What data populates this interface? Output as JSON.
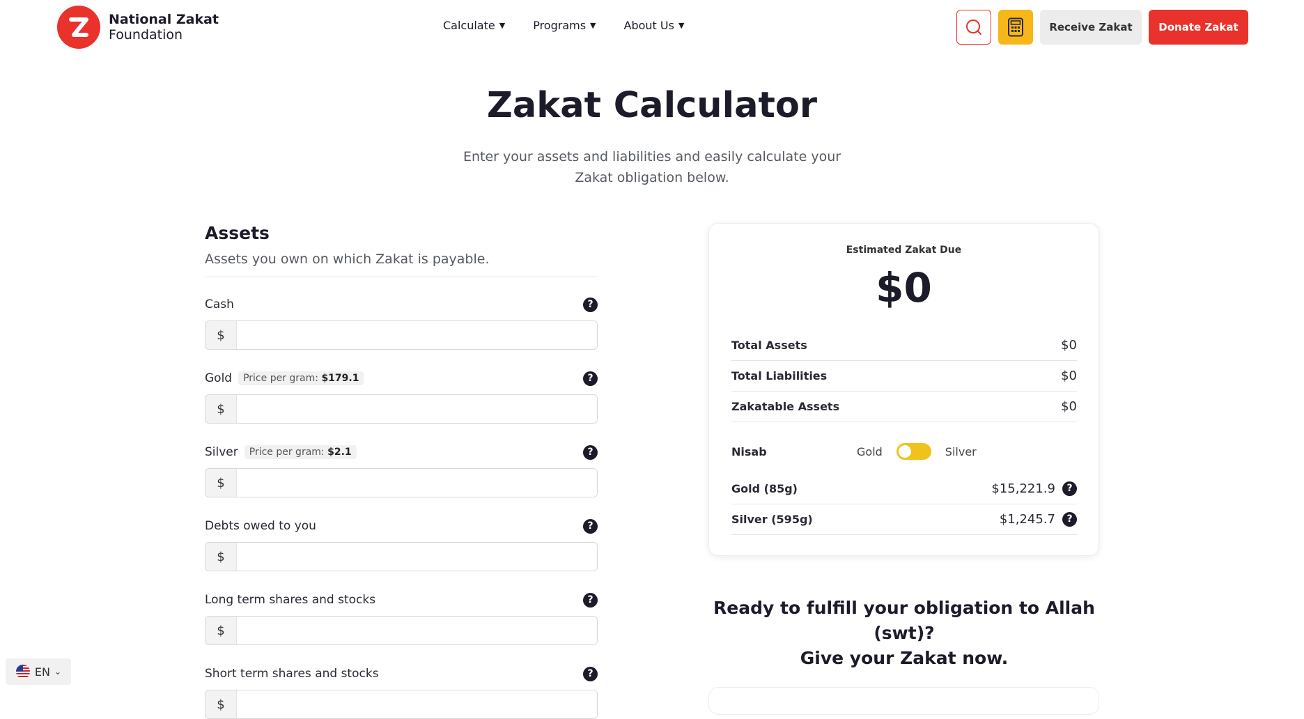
{
  "header": {
    "logo_line1": "National Zakat",
    "logo_line2": "Foundation",
    "nav": [
      {
        "label": "Calculate"
      },
      {
        "label": "Programs"
      },
      {
        "label": "About Us"
      }
    ],
    "receive_label": "Receive Zakat",
    "donate_label": "Donate Zakat",
    "icons": {
      "search": "search-icon",
      "calculator": "calculator-icon"
    },
    "colors": {
      "brand_red": "#e8322b",
      "accent_yellow": "#f7b718"
    }
  },
  "hero": {
    "title": "Zakat Calculator",
    "subtitle": "Enter your assets and liabilities and easily calculate your Zakat obligation below."
  },
  "assets": {
    "heading": "Assets",
    "description": "Assets you own on which Zakat is payable.",
    "fields": [
      {
        "label": "Cash",
        "prefix": "$",
        "value": ""
      },
      {
        "label": "Gold",
        "price_label": "Price per gram:",
        "price_value": "$179.1",
        "prefix": "$",
        "value": ""
      },
      {
        "label": "Silver",
        "price_label": "Price per gram:",
        "price_value": "$2.1",
        "prefix": "$",
        "value": ""
      },
      {
        "label": "Debts owed to you",
        "prefix": "$",
        "value": ""
      },
      {
        "label": "Long term shares and stocks",
        "prefix": "$",
        "value": ""
      },
      {
        "label": "Short term shares and stocks",
        "prefix": "$",
        "value": ""
      }
    ]
  },
  "summary": {
    "estimated_label": "Estimated Zakat Due",
    "estimated_value": "$0",
    "rows": [
      {
        "label": "Total Assets",
        "value": "$0"
      },
      {
        "label": "Total Liabilities",
        "value": "$0"
      },
      {
        "label": "Zakatable Assets",
        "value": "$0"
      }
    ],
    "nisab": {
      "label": "Nisab",
      "option_left": "Gold",
      "option_right": "Silver",
      "selected": "Gold"
    },
    "metals": [
      {
        "label": "Gold (85g)",
        "value": "$15,221.9"
      },
      {
        "label": "Silver (595g)",
        "value": "$1,245.7"
      }
    ]
  },
  "cta": {
    "line1": "Ready to fulfill your obligation to Allah (swt)?",
    "line2": "Give your Zakat now."
  },
  "language": {
    "code": "EN",
    "flag": "us-flag-icon"
  }
}
